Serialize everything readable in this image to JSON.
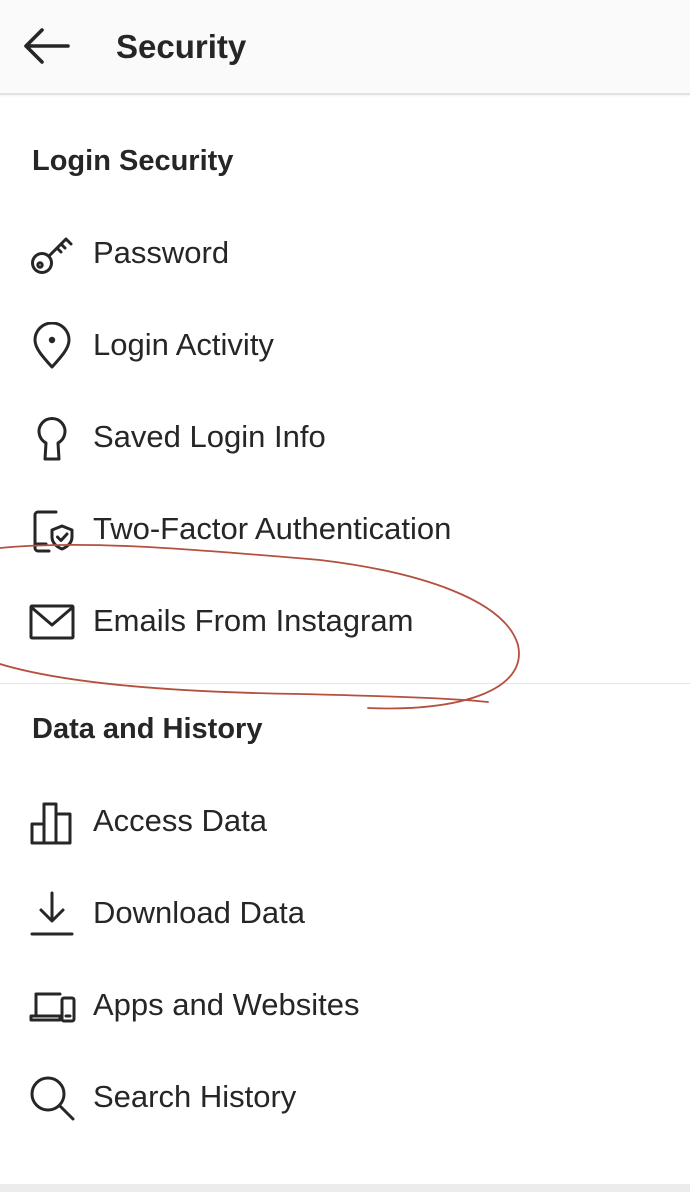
{
  "header": {
    "title": "Security",
    "back_icon": "arrow-left-icon"
  },
  "sections": [
    {
      "title": "Login Security",
      "items": [
        {
          "label": "Password",
          "icon": "key-icon"
        },
        {
          "label": "Login Activity",
          "icon": "location-pin-icon"
        },
        {
          "label": "Saved Login Info",
          "icon": "keyhole-icon"
        },
        {
          "label": "Two-Factor Authentication",
          "icon": "phone-shield-icon"
        },
        {
          "label": "Emails From Instagram",
          "icon": "envelope-icon"
        }
      ]
    },
    {
      "title": "Data and History",
      "items": [
        {
          "label": "Access Data",
          "icon": "bar-chart-icon"
        },
        {
          "label": "Download Data",
          "icon": "download-icon"
        },
        {
          "label": "Apps and Websites",
          "icon": "laptop-phone-icon"
        },
        {
          "label": "Search History",
          "icon": "search-icon"
        }
      ]
    }
  ],
  "colors": {
    "text": "#262626",
    "header_bg": "#fafafa",
    "annotation": "#b5503f"
  }
}
